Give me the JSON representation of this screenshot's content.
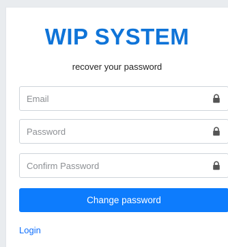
{
  "brand": {
    "title": "WIP SYSTEM",
    "subtitle": "recover your password"
  },
  "form": {
    "email": {
      "placeholder": "Email",
      "value": "",
      "icon": "lock-icon"
    },
    "password": {
      "placeholder": "Password",
      "value": "",
      "icon": "lock-icon"
    },
    "confirm_password": {
      "placeholder": "Confirm Password",
      "value": "",
      "icon": "lock-icon"
    },
    "submit_label": "Change password"
  },
  "footer": {
    "login_link": "Login"
  },
  "colors": {
    "brand": "#0f74d8",
    "primary": "#0d7cfd",
    "background": "#e9ecef"
  }
}
